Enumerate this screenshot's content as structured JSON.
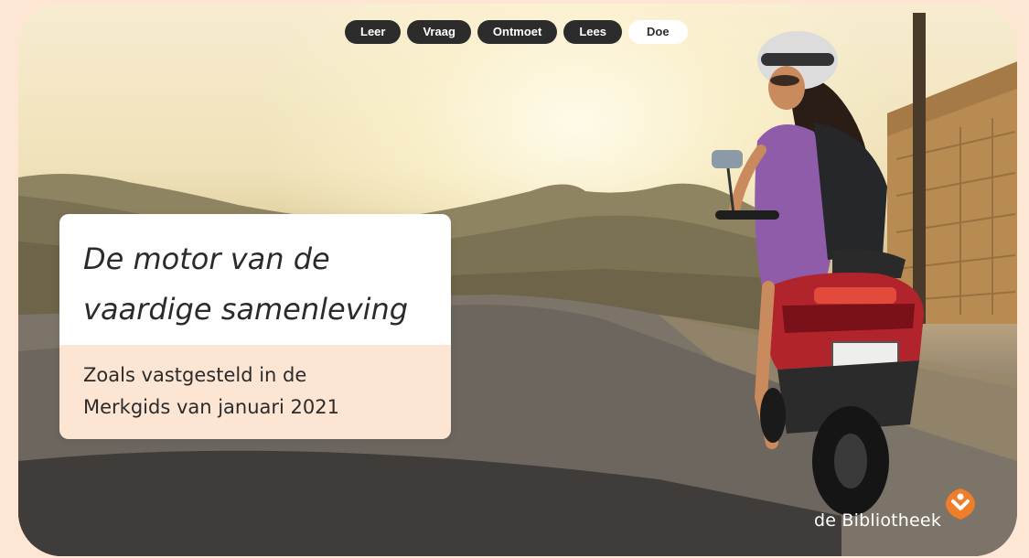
{
  "nav": {
    "items": [
      {
        "label": "Leer",
        "active": false
      },
      {
        "label": "Vraag",
        "active": false
      },
      {
        "label": "Ontmoet",
        "active": false
      },
      {
        "label": "Lees",
        "active": false
      },
      {
        "label": "Doe",
        "active": true
      }
    ]
  },
  "card": {
    "title_line1": "De motor van de",
    "title_line2": "vaardige samenleving",
    "subtitle_line1": "Zoals vastgesteld in de",
    "subtitle_line2": "Merkgids van januari 2021"
  },
  "brand": {
    "name": "de Bibliotheek",
    "accent_color": "#f07d2a",
    "icon": "bibliotheek-logo-icon"
  },
  "colors": {
    "page_background": "#fde6d4",
    "card_bottom": "#fde5d3",
    "pill_dark": "#2c2c2c",
    "pill_active": "#ffffff"
  },
  "hero": {
    "icon": "woman-on-scooter-photo"
  }
}
